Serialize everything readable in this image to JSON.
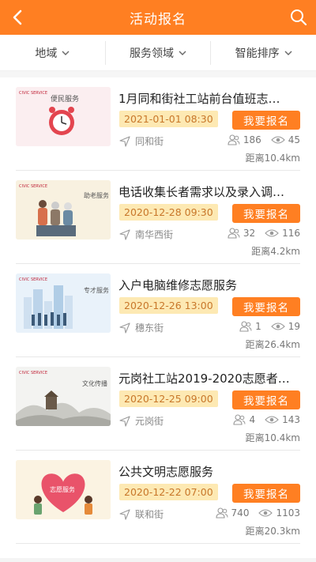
{
  "header": {
    "title": "活动报名",
    "color": "#ff7f22"
  },
  "filters": [
    {
      "label": "地域"
    },
    {
      "label": "服务领域"
    },
    {
      "label": "智能排序"
    }
  ],
  "signup_label": "我要报名",
  "items": [
    {
      "title": "1月同和街社工站前台值班志…",
      "date": "2021-01-01 08:30",
      "location": "同和街",
      "participants": "186",
      "views": "45",
      "distance": "距离10.4km",
      "thumb": {
        "text": "便民服务",
        "bg": "#fbeef0"
      }
    },
    {
      "title": "电话收集长者需求以及录入调…",
      "date": "2020-12-28 09:30",
      "location": "南华西街",
      "participants": "32",
      "views": "116",
      "distance": "距离4.2km",
      "thumb": {
        "text": "助老服务",
        "bg": "#f8f1e0"
      }
    },
    {
      "title": "入户电脑维修志愿服务",
      "date": "2020-12-26 13:00",
      "location": "穗东街",
      "participants": "1",
      "views": "19",
      "distance": "距离26.4km",
      "thumb": {
        "text": "专才服务",
        "bg": "#e9f2fa"
      }
    },
    {
      "title": "元岗社工站2019-2020志愿者…",
      "date": "2020-12-25 09:00",
      "location": "元岗街",
      "participants": "4",
      "views": "143",
      "distance": "距离10.4km",
      "thumb": {
        "text": "文化传播",
        "bg": "#f3f3f1"
      }
    },
    {
      "title": "公共文明志愿服务",
      "date": "2020-12-22 07:00",
      "location": "联和街",
      "participants": "740",
      "views": "1103",
      "distance": "距离20.3km",
      "thumb": {
        "text": "志愿服务",
        "bg": "#fbf3e2"
      }
    }
  ]
}
